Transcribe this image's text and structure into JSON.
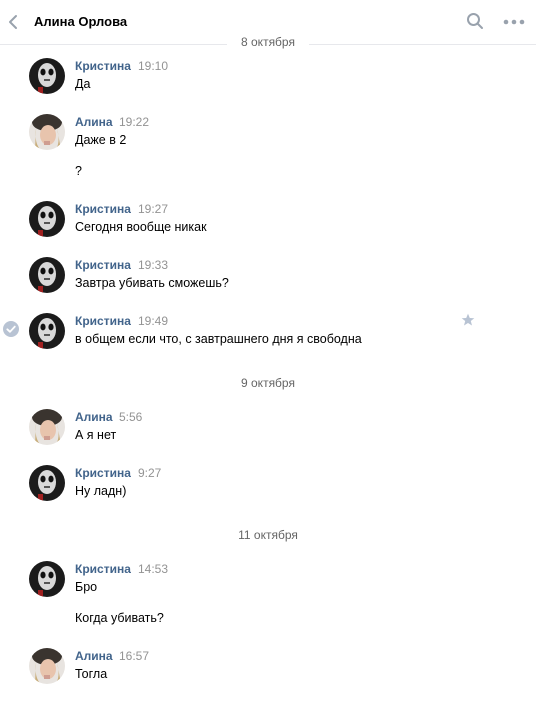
{
  "header": {
    "title": "Алина Орлова"
  },
  "dates": [
    "8 октября",
    "9 октября",
    "11 октября"
  ],
  "messages": [
    {
      "author": "Кристина",
      "time": "19:10",
      "lines": [
        "Да"
      ]
    },
    {
      "author": "Алина",
      "time": "19:22",
      "lines": [
        "Даже в 2",
        "?"
      ]
    },
    {
      "author": "Кристина",
      "time": "19:27",
      "lines": [
        "Сегодня вообще никак"
      ]
    },
    {
      "author": "Кристина",
      "time": "19:33",
      "lines": [
        "Завтра убивать сможешь?"
      ]
    },
    {
      "author": "Кристина",
      "time": "19:49",
      "lines": [
        "в общем если что, с завтрашнего дня я свободна"
      ]
    },
    {
      "author": "Алина",
      "time": "5:56",
      "lines": [
        "А я нет"
      ]
    },
    {
      "author": "Кристина",
      "time": "9:27",
      "lines": [
        "Ну ладн)"
      ]
    },
    {
      "author": "Кристина",
      "time": "14:53",
      "lines": [
        "Бро",
        "Когда убивать?"
      ]
    },
    {
      "author": "Алина",
      "time": "16:57",
      "lines": [
        "Тогла"
      ]
    }
  ]
}
